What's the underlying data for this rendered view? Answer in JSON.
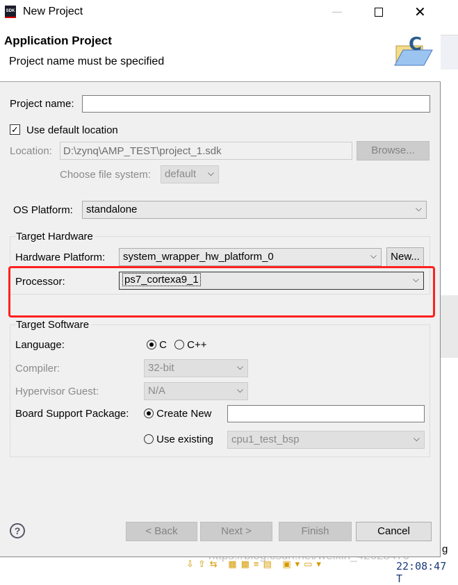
{
  "window": {
    "title": "New Project",
    "app_icon": "SDK"
  },
  "header": {
    "title": "Application Project",
    "message": "Project name must be specified"
  },
  "project_name": {
    "label": "Project name:",
    "value": ""
  },
  "use_default_location": {
    "label": "Use default location",
    "checked": true
  },
  "location": {
    "label": "Location:",
    "value": "D:\\zynq\\AMP_TEST\\project_1.sdk",
    "browse": "Browse..."
  },
  "file_system": {
    "label": "Choose file system:",
    "value": "default"
  },
  "os_platform": {
    "label": "OS Platform:",
    "value": "standalone"
  },
  "target_hardware": {
    "title": "Target Hardware",
    "hw_label": "Hardware Platform:",
    "hw_value": "system_wrapper_hw_platform_0",
    "new_button": "New...",
    "proc_label": "Processor:",
    "proc_value": "ps7_cortexa9_1",
    "highlight_color": "#ff2020"
  },
  "target_software": {
    "title": "Target Software",
    "language_label": "Language:",
    "lang_c": "C",
    "lang_cpp": "C++",
    "language_selected": "C",
    "compiler_label": "Compiler:",
    "compiler_value": "32-bit",
    "hyp_label": "Hypervisor Guest:",
    "hyp_value": "N/A",
    "bsp_label": "Board Support Package:",
    "create_new": "Create New",
    "create_new_value": "",
    "use_existing": "Use existing",
    "existing_value": "cpu1_test_bsp",
    "bsp_selected": "Create New"
  },
  "buttons": {
    "back": "< Back",
    "next": "Next >",
    "finish": "Finish",
    "cancel": "Cancel"
  },
  "background": {
    "tab_fragment": "g",
    "time_fragment": "22:08:47 T",
    "watermark": "https://blog.csdn.net/weixin_42628470"
  }
}
